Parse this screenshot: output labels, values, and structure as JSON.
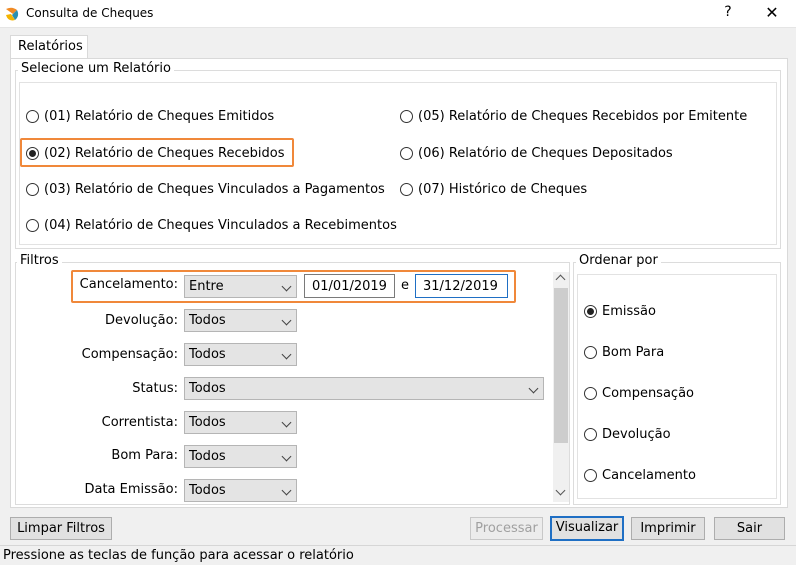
{
  "window": {
    "title": "Consulta de Cheques",
    "help": "?",
    "close": "✕"
  },
  "tab": {
    "label": "Relatórios"
  },
  "report_group": {
    "legend": "Selecione um Relatório",
    "options": [
      {
        "label": "(01) Relatório de Cheques Emitidos",
        "checked": false
      },
      {
        "label": "(02) Relatório de Cheques Recebidos",
        "checked": true
      },
      {
        "label": "(03) Relatório de Cheques Vinculados a Pagamentos",
        "checked": false
      },
      {
        "label": "(04) Relatório de Cheques Vinculados a Recebimentos",
        "checked": false
      },
      {
        "label": "(05) Relatório de Cheques Recebidos por Emitente",
        "checked": false
      },
      {
        "label": "(06) Relatório de Cheques Depositados",
        "checked": false
      },
      {
        "label": "(07) Histórico de Cheques",
        "checked": false
      }
    ]
  },
  "filters": {
    "legend": "Filtros",
    "cancelamento": {
      "label": "Cancelamento:",
      "mode": "Entre",
      "from": "01/01/2019",
      "connector": "e",
      "to": "31/12/2019"
    },
    "devolucao": {
      "label": "Devolução:",
      "value": "Todos"
    },
    "compensacao": {
      "label": "Compensação:",
      "value": "Todos"
    },
    "status": {
      "label": "Status:",
      "value": "Todos"
    },
    "correntista": {
      "label": "Correntista:",
      "value": "Todos"
    },
    "bom_para": {
      "label": "Bom Para:",
      "value": "Todos"
    },
    "data_emissao": {
      "label": "Data Emissão:",
      "value": "Todos"
    }
  },
  "order": {
    "legend": "Ordenar por",
    "options": [
      {
        "label": "Emissão",
        "checked": true
      },
      {
        "label": "Bom Para",
        "checked": false
      },
      {
        "label": "Compensação",
        "checked": false
      },
      {
        "label": "Devolução",
        "checked": false
      },
      {
        "label": "Cancelamento",
        "checked": false
      }
    ]
  },
  "buttons": {
    "limpar": "Limpar Filtros",
    "processar": "Processar",
    "visualizar": "Visualizar",
    "imprimir": "Imprimir",
    "sair": "Sair"
  },
  "status_bar": "Pressione as teclas de função para acessar o relatório",
  "colors": {
    "highlight": "#f0883a",
    "default_button_border": "#1f6fc4",
    "icon_orange": "#f08a24",
    "icon_teal": "#2a8fb0"
  }
}
